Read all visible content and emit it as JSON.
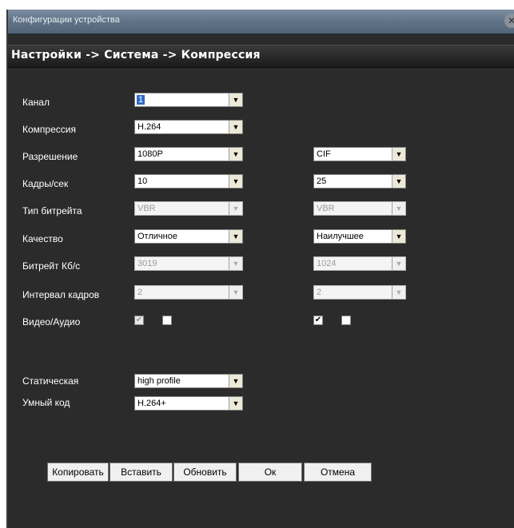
{
  "window": {
    "title": "Конфигурации устройства",
    "close_symbol": "✕"
  },
  "breadcrumb": "Настройки -> Система -> Компрессия",
  "form": {
    "labels": {
      "channel": "Канал",
      "compression": "Компрессия",
      "resolution": "Разрешение",
      "fps": "Кадры/сек",
      "bitrate_type": "Тип битрейта",
      "quality": "Качество",
      "bitrate": "Битрейт Кб/с",
      "gop": "Интервал кадров",
      "video_audio": "Видео/Аудио",
      "static": "Статическая",
      "smart_code": "Умный код"
    },
    "main": {
      "channel": "1",
      "compression": "H.264",
      "resolution": "1080P",
      "fps": "10",
      "bitrate_type": "VBR",
      "quality": "Отличное",
      "bitrate": "3019",
      "gop": "2",
      "video_checked": true,
      "audio_checked": false
    },
    "extra": {
      "resolution": "CIF",
      "fps": "25",
      "bitrate_type": "VBR",
      "quality": "Наилучшее",
      "bitrate": "1024",
      "gop": "2",
      "video_checked": true,
      "audio_checked": false
    },
    "static": "high profile",
    "smart_code": "H.264+"
  },
  "buttons": {
    "copy": "Копировать",
    "paste": "Вставить",
    "refresh": "Обновить",
    "ok": "Ок",
    "cancel": "Отмена"
  },
  "icons": {
    "dropdown_arrow": "▼",
    "check": "✔"
  },
  "colors": {
    "panel": "#2b2b2b",
    "titlebar": "#607386",
    "selection": "#316ac5"
  }
}
